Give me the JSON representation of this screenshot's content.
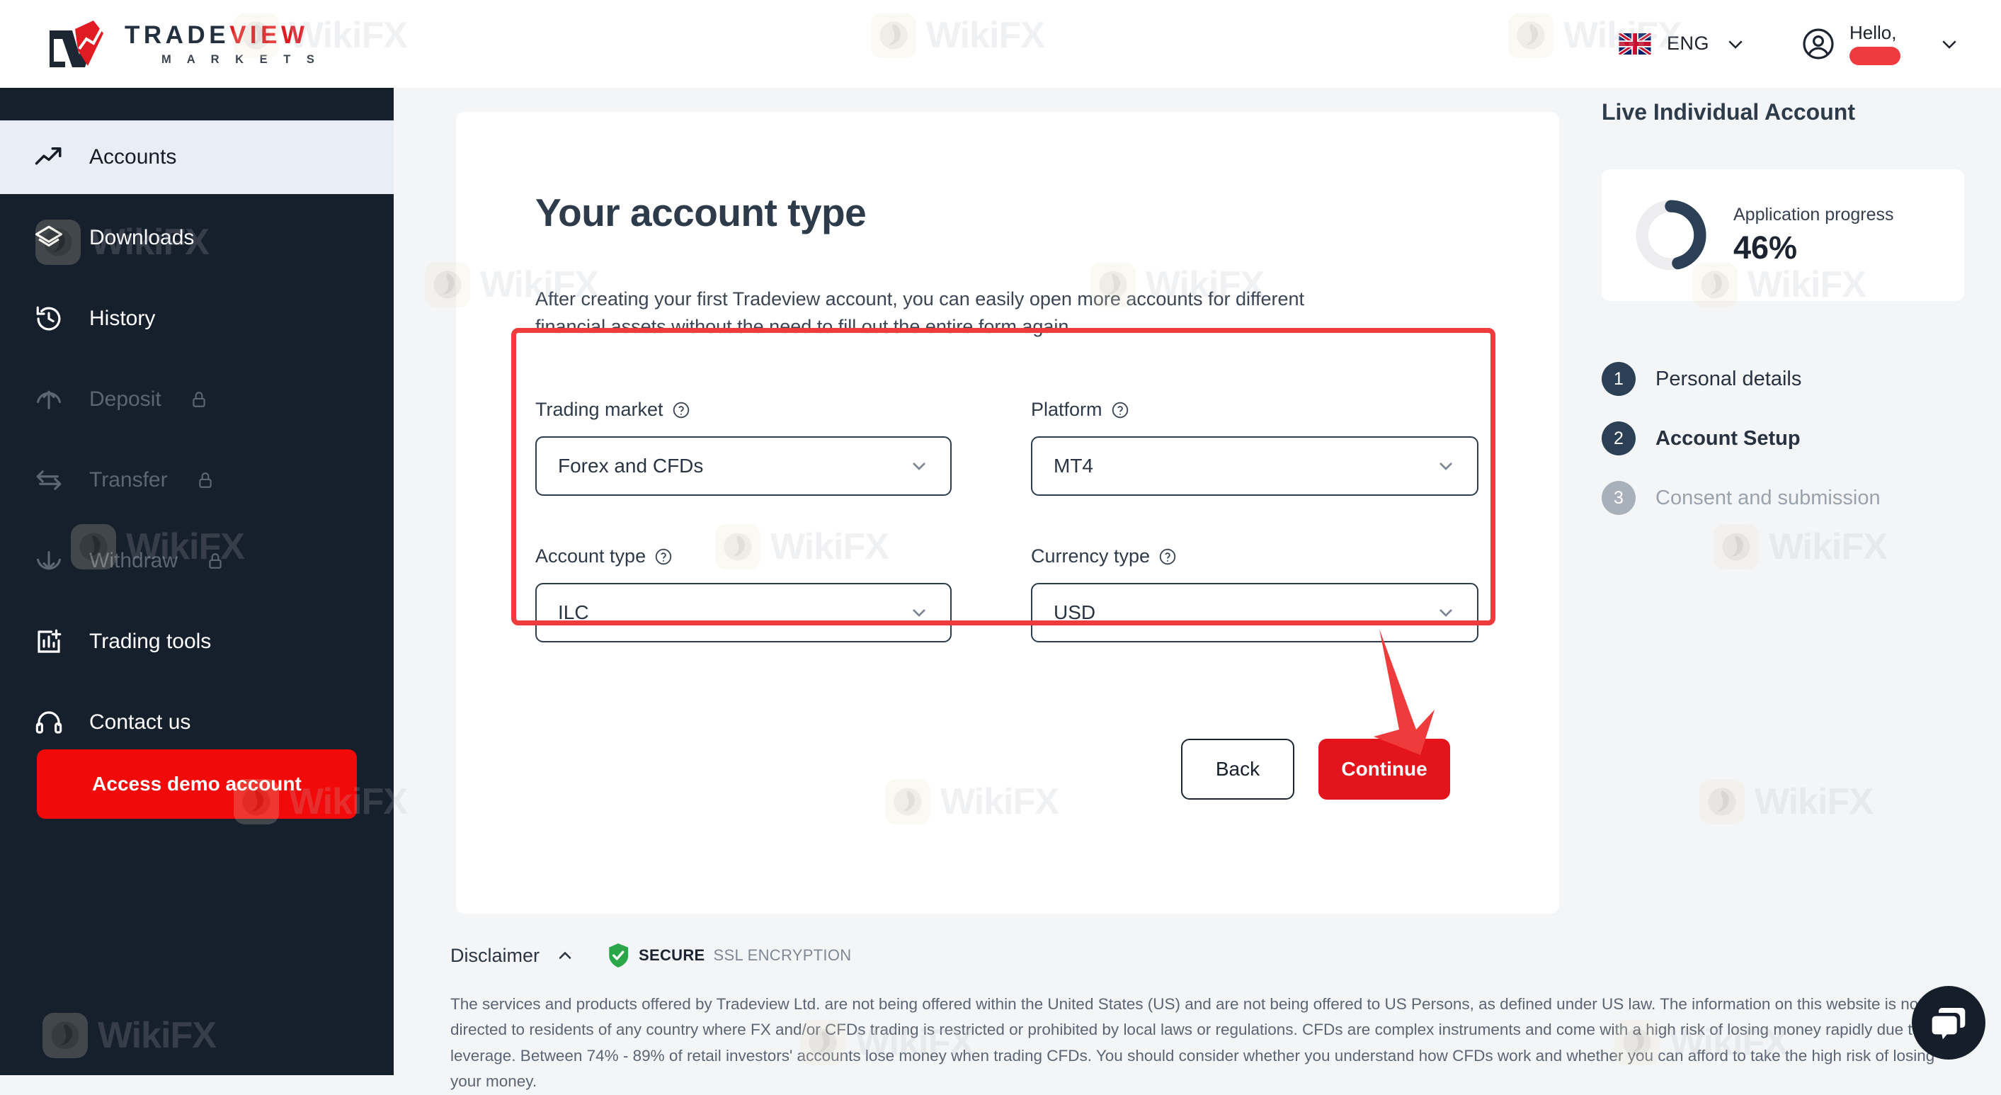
{
  "header": {
    "logo": {
      "word_dark": "TRADE",
      "word_red": "VIEW",
      "subtitle": "M A R K E T S"
    },
    "language": {
      "code": "ENG",
      "flag": "uk-flag-icon",
      "chevron": "chevron-down-icon"
    },
    "user": {
      "greeting": "Hello,",
      "name_redacted": "",
      "avatar": "user-circle-icon",
      "chevron": "chevron-down-icon"
    }
  },
  "sidebar": {
    "items": [
      {
        "label": "Accounts",
        "icon": "trending-up-icon",
        "active": true,
        "locked": false
      },
      {
        "label": "Downloads",
        "icon": "layers-icon",
        "active": false,
        "locked": false
      },
      {
        "label": "History",
        "icon": "clock-rewind-icon",
        "active": false,
        "locked": false
      },
      {
        "label": "Deposit",
        "icon": "arrow-up-circle-icon",
        "active": false,
        "locked": true
      },
      {
        "label": "Transfer",
        "icon": "transfer-arrows-icon",
        "active": false,
        "locked": true
      },
      {
        "label": "Withdraw",
        "icon": "arrow-down-circle-icon",
        "active": false,
        "locked": true
      },
      {
        "label": "Trading tools",
        "icon": "bar-chart-plus-icon",
        "active": false,
        "locked": false
      },
      {
        "label": "Contact us",
        "icon": "headset-icon",
        "active": false,
        "locked": false
      }
    ],
    "demo_button": "Access demo account"
  },
  "main": {
    "title": "Your account type",
    "description": "After creating your first Tradeview account, you can easily open more accounts for different financial assets without the need to fill out the entire form again.",
    "fields": [
      {
        "label": "Trading market",
        "value": "Forex and CFDs",
        "help": "help-circle-icon"
      },
      {
        "label": "Platform",
        "value": "MT4",
        "help": "help-circle-icon"
      },
      {
        "label": "Account type",
        "value": "ILC",
        "help": "help-circle-icon"
      },
      {
        "label": "Currency type",
        "value": "USD",
        "help": "help-circle-icon"
      }
    ],
    "back_button": "Back",
    "continue_button": "Continue"
  },
  "right_panel": {
    "title": "Live Individual Account",
    "progress": {
      "label": "Application progress",
      "value": "46%",
      "percent": 46
    },
    "steps": [
      {
        "num": "1",
        "label": "Personal details",
        "state": "done"
      },
      {
        "num": "2",
        "label": "Account Setup",
        "state": "current"
      },
      {
        "num": "3",
        "label": "Consent and submission",
        "state": "pending"
      }
    ]
  },
  "footer": {
    "disclaimer_label": "Disclaimer",
    "caret": "caret-up-icon",
    "ssl_bold": "SECURE",
    "ssl_rest": "SSL ENCRYPTION",
    "shield": "shield-check-icon",
    "text": "The services and products offered by Tradeview Ltd. are not being offered within the United States (US) and are not being offered to US Persons, as defined under US law. The information on this website is not directed to residents of any country where FX and/or CFDs trading is restricted or prohibited by local laws or regulations. CFDs are complex instruments and come with a high risk of losing money rapidly due to leverage. Between 74% - 89% of retail investors' accounts lose money when trading CFDs. You should consider whether you understand how CFDs work and whether you can afford to take the high risk of losing your money."
  },
  "chat": {
    "icon": "chat-bubbles-icon"
  },
  "annotations": {
    "highlight_color": "#ee3b3b",
    "arrow": "red-arrow-down-icon"
  },
  "watermark": {
    "text": "WikiFX"
  }
}
